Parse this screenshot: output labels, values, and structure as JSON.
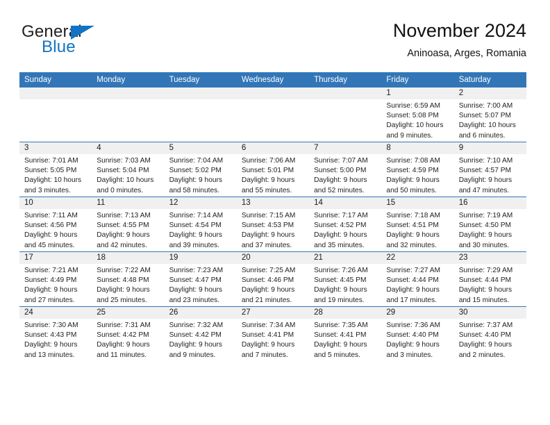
{
  "brand": {
    "name_part1": "General",
    "name_part2": "Blue",
    "triangle_icon": "triangle-icon",
    "accent_color": "#1273c4"
  },
  "header": {
    "title": "November 2024",
    "subtitle": "Aninoasa, Arges, Romania"
  },
  "colors": {
    "header_blue": "#3276b8",
    "row_divider_blue": "#3276b8",
    "daynum_band_gray": "#f0f0f0",
    "text": "#222222"
  },
  "calendar": {
    "weekday_headers": [
      "Sunday",
      "Monday",
      "Tuesday",
      "Wednesday",
      "Thursday",
      "Friday",
      "Saturday"
    ],
    "weeks": [
      [
        {
          "day": "",
          "lines": []
        },
        {
          "day": "",
          "lines": []
        },
        {
          "day": "",
          "lines": []
        },
        {
          "day": "",
          "lines": []
        },
        {
          "day": "",
          "lines": []
        },
        {
          "day": "1",
          "lines": [
            "Sunrise: 6:59 AM",
            "Sunset: 5:08 PM",
            "Daylight: 10 hours",
            "and 9 minutes."
          ]
        },
        {
          "day": "2",
          "lines": [
            "Sunrise: 7:00 AM",
            "Sunset: 5:07 PM",
            "Daylight: 10 hours",
            "and 6 minutes."
          ]
        }
      ],
      [
        {
          "day": "3",
          "lines": [
            "Sunrise: 7:01 AM",
            "Sunset: 5:05 PM",
            "Daylight: 10 hours",
            "and 3 minutes."
          ]
        },
        {
          "day": "4",
          "lines": [
            "Sunrise: 7:03 AM",
            "Sunset: 5:04 PM",
            "Daylight: 10 hours",
            "and 0 minutes."
          ]
        },
        {
          "day": "5",
          "lines": [
            "Sunrise: 7:04 AM",
            "Sunset: 5:02 PM",
            "Daylight: 9 hours",
            "and 58 minutes."
          ]
        },
        {
          "day": "6",
          "lines": [
            "Sunrise: 7:06 AM",
            "Sunset: 5:01 PM",
            "Daylight: 9 hours",
            "and 55 minutes."
          ]
        },
        {
          "day": "7",
          "lines": [
            "Sunrise: 7:07 AM",
            "Sunset: 5:00 PM",
            "Daylight: 9 hours",
            "and 52 minutes."
          ]
        },
        {
          "day": "8",
          "lines": [
            "Sunrise: 7:08 AM",
            "Sunset: 4:59 PM",
            "Daylight: 9 hours",
            "and 50 minutes."
          ]
        },
        {
          "day": "9",
          "lines": [
            "Sunrise: 7:10 AM",
            "Sunset: 4:57 PM",
            "Daylight: 9 hours",
            "and 47 minutes."
          ]
        }
      ],
      [
        {
          "day": "10",
          "lines": [
            "Sunrise: 7:11 AM",
            "Sunset: 4:56 PM",
            "Daylight: 9 hours",
            "and 45 minutes."
          ]
        },
        {
          "day": "11",
          "lines": [
            "Sunrise: 7:13 AM",
            "Sunset: 4:55 PM",
            "Daylight: 9 hours",
            "and 42 minutes."
          ]
        },
        {
          "day": "12",
          "lines": [
            "Sunrise: 7:14 AM",
            "Sunset: 4:54 PM",
            "Daylight: 9 hours",
            "and 39 minutes."
          ]
        },
        {
          "day": "13",
          "lines": [
            "Sunrise: 7:15 AM",
            "Sunset: 4:53 PM",
            "Daylight: 9 hours",
            "and 37 minutes."
          ]
        },
        {
          "day": "14",
          "lines": [
            "Sunrise: 7:17 AM",
            "Sunset: 4:52 PM",
            "Daylight: 9 hours",
            "and 35 minutes."
          ]
        },
        {
          "day": "15",
          "lines": [
            "Sunrise: 7:18 AM",
            "Sunset: 4:51 PM",
            "Daylight: 9 hours",
            "and 32 minutes."
          ]
        },
        {
          "day": "16",
          "lines": [
            "Sunrise: 7:19 AM",
            "Sunset: 4:50 PM",
            "Daylight: 9 hours",
            "and 30 minutes."
          ]
        }
      ],
      [
        {
          "day": "17",
          "lines": [
            "Sunrise: 7:21 AM",
            "Sunset: 4:49 PM",
            "Daylight: 9 hours",
            "and 27 minutes."
          ]
        },
        {
          "day": "18",
          "lines": [
            "Sunrise: 7:22 AM",
            "Sunset: 4:48 PM",
            "Daylight: 9 hours",
            "and 25 minutes."
          ]
        },
        {
          "day": "19",
          "lines": [
            "Sunrise: 7:23 AM",
            "Sunset: 4:47 PM",
            "Daylight: 9 hours",
            "and 23 minutes."
          ]
        },
        {
          "day": "20",
          "lines": [
            "Sunrise: 7:25 AM",
            "Sunset: 4:46 PM",
            "Daylight: 9 hours",
            "and 21 minutes."
          ]
        },
        {
          "day": "21",
          "lines": [
            "Sunrise: 7:26 AM",
            "Sunset: 4:45 PM",
            "Daylight: 9 hours",
            "and 19 minutes."
          ]
        },
        {
          "day": "22",
          "lines": [
            "Sunrise: 7:27 AM",
            "Sunset: 4:44 PM",
            "Daylight: 9 hours",
            "and 17 minutes."
          ]
        },
        {
          "day": "23",
          "lines": [
            "Sunrise: 7:29 AM",
            "Sunset: 4:44 PM",
            "Daylight: 9 hours",
            "and 15 minutes."
          ]
        }
      ],
      [
        {
          "day": "24",
          "lines": [
            "Sunrise: 7:30 AM",
            "Sunset: 4:43 PM",
            "Daylight: 9 hours",
            "and 13 minutes."
          ]
        },
        {
          "day": "25",
          "lines": [
            "Sunrise: 7:31 AM",
            "Sunset: 4:42 PM",
            "Daylight: 9 hours",
            "and 11 minutes."
          ]
        },
        {
          "day": "26",
          "lines": [
            "Sunrise: 7:32 AM",
            "Sunset: 4:42 PM",
            "Daylight: 9 hours",
            "and 9 minutes."
          ]
        },
        {
          "day": "27",
          "lines": [
            "Sunrise: 7:34 AM",
            "Sunset: 4:41 PM",
            "Daylight: 9 hours",
            "and 7 minutes."
          ]
        },
        {
          "day": "28",
          "lines": [
            "Sunrise: 7:35 AM",
            "Sunset: 4:41 PM",
            "Daylight: 9 hours",
            "and 5 minutes."
          ]
        },
        {
          "day": "29",
          "lines": [
            "Sunrise: 7:36 AM",
            "Sunset: 4:40 PM",
            "Daylight: 9 hours",
            "and 3 minutes."
          ]
        },
        {
          "day": "30",
          "lines": [
            "Sunrise: 7:37 AM",
            "Sunset: 4:40 PM",
            "Daylight: 9 hours",
            "and 2 minutes."
          ]
        }
      ]
    ]
  }
}
